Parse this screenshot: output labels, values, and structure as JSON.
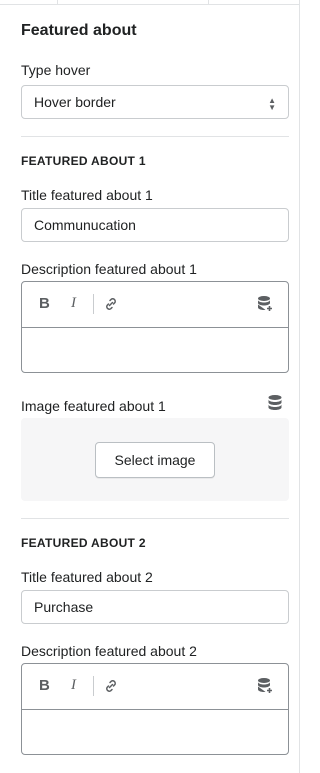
{
  "header": {
    "title": "Featured about"
  },
  "type_hover": {
    "label": "Type hover",
    "value": "Hover border"
  },
  "featured_1": {
    "section_title": "FEATURED ABOUT 1",
    "title_label": "Title featured about 1",
    "title_value": "Communucation",
    "description_label": "Description featured about 1",
    "description_toolbar": {
      "bold": "B",
      "italic": "I"
    },
    "image_label": "Image featured about 1",
    "select_image_button": "Select image"
  },
  "featured_2": {
    "section_title": "FEATURED ABOUT 2",
    "title_label": "Title featured about 2",
    "title_value": "Purchase",
    "description_label": "Description featured about 2",
    "description_toolbar": {
      "bold": "B",
      "italic": "I"
    }
  },
  "icons": [
    "select-arrows-icon",
    "bold-icon",
    "italic-icon",
    "link-icon",
    "dynamic-source-icon",
    "database-icon"
  ]
}
